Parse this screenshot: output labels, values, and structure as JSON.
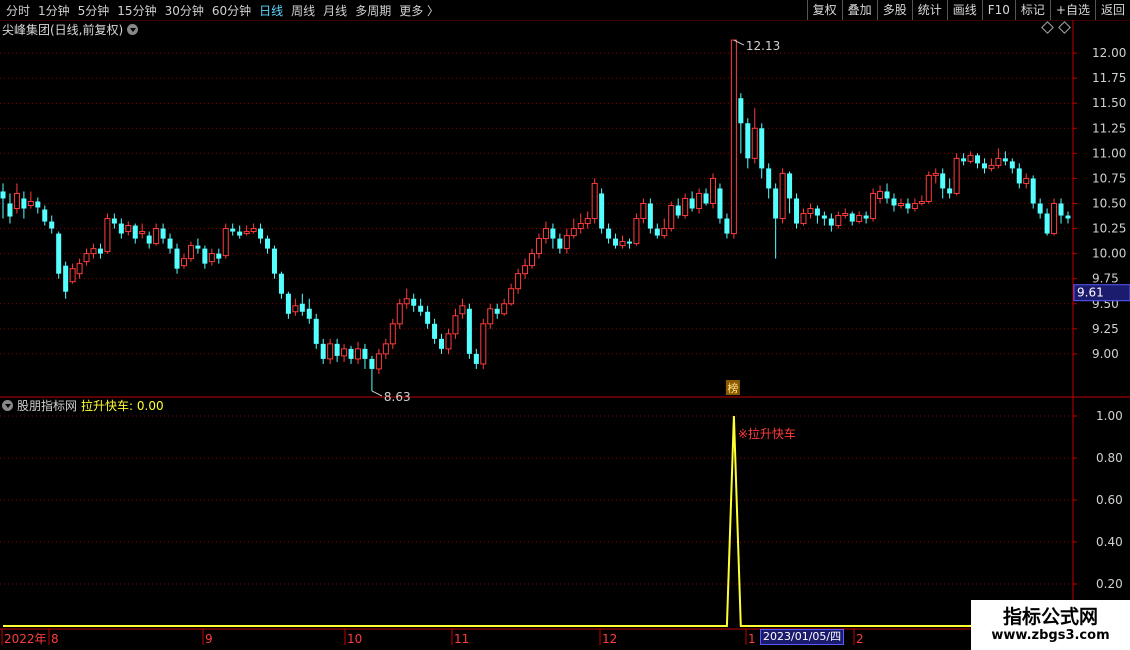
{
  "toolbar": {
    "periods": [
      {
        "label": "分时",
        "active": false
      },
      {
        "label": "1分钟",
        "active": false
      },
      {
        "label": "5分钟",
        "active": false
      },
      {
        "label": "15分钟",
        "active": false
      },
      {
        "label": "30分钟",
        "active": false
      },
      {
        "label": "60分钟",
        "active": false
      },
      {
        "label": "日线",
        "active": true
      },
      {
        "label": "周线",
        "active": false
      },
      {
        "label": "月线",
        "active": false
      },
      {
        "label": "多周期",
        "active": false
      },
      {
        "label": "更多 〉",
        "active": false
      }
    ],
    "right_buttons": [
      "复权",
      "叠加",
      "多股",
      "统计",
      "画线",
      "F10",
      "标记",
      "+自选",
      "返回"
    ]
  },
  "stock": {
    "title": "尖峰集团(日线,前复权)",
    "high_label": "12.13",
    "low_label": "8.63",
    "current_price_tag": "9.61",
    "rank_badge": "榜"
  },
  "price_axis": {
    "labels": [
      "12.00",
      "11.75",
      "11.50",
      "11.25",
      "11.00",
      "10.75",
      "10.50",
      "10.25",
      "10.00",
      "9.75",
      "9.50",
      "9.25",
      "9.00"
    ]
  },
  "indicator": {
    "name": "股朋指标网",
    "series_label": "拉升快车: 0.00",
    "signal_label": "※拉升快车",
    "axis_labels": [
      "1.00",
      "0.80",
      "0.60",
      "0.40",
      "0.20"
    ]
  },
  "time_axis": {
    "labels": [
      "2022年",
      "8",
      "9",
      "10",
      "11",
      "12",
      "1",
      "2"
    ],
    "selected_date": "2023/01/05/四"
  },
  "watermark": {
    "title": "指标公式网",
    "url": "www.zbgs3.com"
  },
  "colors": {
    "up": "#ff3c3c",
    "down": "#54ffff",
    "indicator_line": "#ffff33",
    "grid": "#8a0000",
    "axis_line": "#c00000"
  },
  "chart_data": {
    "type": "candlestick",
    "price_range": [
      8.6,
      12.2
    ],
    "candles": [
      [
        10.62,
        10.55,
        10.7,
        10.35
      ],
      [
        10.5,
        10.37,
        10.6,
        10.3
      ],
      [
        10.45,
        10.6,
        10.7,
        10.4
      ],
      [
        10.55,
        10.45,
        10.62,
        10.35
      ],
      [
        10.48,
        10.52,
        10.62,
        10.45
      ],
      [
        10.52,
        10.46,
        10.56,
        10.4
      ],
      [
        10.44,
        10.32,
        10.48,
        10.28
      ],
      [
        10.32,
        10.25,
        10.38,
        10.2
      ],
      [
        10.2,
        9.8,
        10.22,
        9.75
      ],
      [
        9.88,
        9.62,
        9.92,
        9.55
      ],
      [
        9.72,
        9.85,
        9.9,
        9.7
      ],
      [
        9.8,
        9.9,
        9.95,
        9.75
      ],
      [
        9.92,
        10.0,
        10.05,
        9.88
      ],
      [
        10.0,
        10.05,
        10.1,
        9.95
      ],
      [
        10.05,
        10.0,
        10.1,
        9.95
      ],
      [
        10.02,
        10.35,
        10.4,
        10.0
      ],
      [
        10.35,
        10.3,
        10.4,
        10.25
      ],
      [
        10.3,
        10.2,
        10.35,
        10.15
      ],
      [
        10.22,
        10.28,
        10.32,
        10.18
      ],
      [
        10.28,
        10.15,
        10.3,
        10.1
      ],
      [
        10.2,
        10.22,
        10.3,
        10.15
      ],
      [
        10.18,
        10.1,
        10.22,
        10.05
      ],
      [
        10.1,
        10.25,
        10.3,
        10.08
      ],
      [
        10.25,
        10.15,
        10.3,
        10.1
      ],
      [
        10.15,
        10.05,
        10.2,
        10.0
      ],
      [
        10.05,
        9.85,
        10.1,
        9.8
      ],
      [
        9.88,
        9.95,
        10.0,
        9.85
      ],
      [
        9.95,
        10.08,
        10.12,
        9.92
      ],
      [
        10.08,
        10.05,
        10.15,
        10.0
      ],
      [
        10.05,
        9.9,
        10.08,
        9.85
      ],
      [
        9.92,
        10.0,
        10.05,
        9.88
      ],
      [
        10.0,
        9.95,
        10.05,
        9.9
      ],
      [
        9.98,
        10.25,
        10.3,
        9.95
      ],
      [
        10.25,
        10.22,
        10.3,
        10.18
      ],
      [
        10.22,
        10.18,
        10.28,
        10.15
      ],
      [
        10.2,
        10.22,
        10.28,
        10.18
      ],
      [
        10.22,
        10.25,
        10.3,
        10.2
      ],
      [
        10.25,
        10.15,
        10.3,
        10.1
      ],
      [
        10.15,
        10.05,
        10.18,
        10.0
      ],
      [
        10.05,
        9.8,
        10.08,
        9.75
      ],
      [
        9.8,
        9.6,
        9.82,
        9.55
      ],
      [
        9.6,
        9.4,
        9.62,
        9.35
      ],
      [
        9.42,
        9.48,
        9.55,
        9.38
      ],
      [
        9.5,
        9.42,
        9.6,
        9.38
      ],
      [
        9.45,
        9.35,
        9.55,
        9.3
      ],
      [
        9.35,
        9.1,
        9.4,
        9.05
      ],
      [
        9.1,
        8.95,
        9.15,
        8.9
      ],
      [
        8.95,
        9.1,
        9.15,
        8.9
      ],
      [
        9.1,
        8.98,
        9.15,
        8.92
      ],
      [
        8.98,
        9.05,
        9.1,
        8.92
      ],
      [
        9.05,
        8.95,
        9.08,
        8.9
      ],
      [
        8.95,
        9.05,
        9.12,
        8.9
      ],
      [
        9.05,
        8.95,
        9.1,
        8.85
      ],
      [
        8.95,
        8.85,
        8.98,
        8.63
      ],
      [
        8.85,
        9.0,
        9.05,
        8.8
      ],
      [
        9.0,
        9.1,
        9.15,
        8.95
      ],
      [
        9.1,
        9.3,
        9.35,
        9.05
      ],
      [
        9.3,
        9.5,
        9.55,
        9.25
      ],
      [
        9.5,
        9.55,
        9.65,
        9.45
      ],
      [
        9.55,
        9.48,
        9.6,
        9.42
      ],
      [
        9.48,
        9.42,
        9.55,
        9.38
      ],
      [
        9.42,
        9.3,
        9.48,
        9.25
      ],
      [
        9.3,
        9.15,
        9.35,
        9.1
      ],
      [
        9.15,
        9.05,
        9.2,
        9.0
      ],
      [
        9.05,
        9.2,
        9.25,
        9.0
      ],
      [
        9.2,
        9.38,
        9.45,
        9.15
      ],
      [
        9.4,
        9.48,
        9.55,
        9.35
      ],
      [
        9.45,
        9.0,
        9.5,
        8.95
      ],
      [
        9.0,
        8.9,
        9.05,
        8.85
      ],
      [
        8.9,
        9.3,
        9.35,
        8.85
      ],
      [
        9.3,
        9.45,
        9.5,
        9.25
      ],
      [
        9.45,
        9.4,
        9.5,
        9.35
      ],
      [
        9.4,
        9.5,
        9.55,
        9.38
      ],
      [
        9.5,
        9.65,
        9.7,
        9.48
      ],
      [
        9.65,
        9.8,
        9.85,
        9.6
      ],
      [
        9.8,
        9.88,
        9.95,
        9.75
      ],
      [
        9.88,
        10.0,
        10.05,
        9.85
      ],
      [
        10.0,
        10.15,
        10.2,
        9.95
      ],
      [
        10.15,
        10.25,
        10.32,
        10.1
      ],
      [
        10.25,
        10.15,
        10.3,
        10.05
      ],
      [
        10.15,
        10.05,
        10.2,
        10.0
      ],
      [
        10.05,
        10.18,
        10.25,
        10.0
      ],
      [
        10.18,
        10.25,
        10.35,
        10.15
      ],
      [
        10.25,
        10.3,
        10.4,
        10.2
      ],
      [
        10.3,
        10.35,
        10.42,
        10.25
      ],
      [
        10.35,
        10.7,
        10.75,
        10.3
      ],
      [
        10.6,
        10.25,
        10.65,
        10.2
      ],
      [
        10.25,
        10.15,
        10.3,
        10.1
      ],
      [
        10.15,
        10.08,
        10.2,
        10.05
      ],
      [
        10.08,
        10.12,
        10.18,
        10.05
      ],
      [
        10.12,
        10.1,
        10.15,
        10.05
      ],
      [
        10.1,
        10.35,
        10.4,
        10.08
      ],
      [
        10.35,
        10.5,
        10.55,
        10.3
      ],
      [
        10.5,
        10.25,
        10.55,
        10.2
      ],
      [
        10.25,
        10.18,
        10.3,
        10.15
      ],
      [
        10.18,
        10.25,
        10.35,
        10.15
      ],
      [
        10.25,
        10.48,
        10.52,
        10.22
      ],
      [
        10.48,
        10.38,
        10.55,
        10.35
      ],
      [
        10.38,
        10.55,
        10.6,
        10.35
      ],
      [
        10.55,
        10.45,
        10.62,
        10.42
      ],
      [
        10.45,
        10.6,
        10.65,
        10.4
      ],
      [
        10.6,
        10.5,
        10.65,
        10.48
      ],
      [
        10.5,
        10.75,
        10.8,
        10.45
      ],
      [
        10.65,
        10.35,
        10.7,
        10.3
      ],
      [
        10.35,
        10.2,
        10.4,
        10.15
      ],
      [
        10.2,
        12.13,
        12.13,
        10.15
      ],
      [
        11.55,
        11.3,
        11.6,
        11.0
      ],
      [
        11.3,
        10.95,
        11.35,
        10.85
      ],
      [
        10.95,
        11.25,
        11.45,
        10.9
      ],
      [
        11.25,
        10.85,
        11.3,
        10.75
      ],
      [
        10.85,
        10.65,
        10.9,
        10.55
      ],
      [
        10.65,
        10.35,
        10.7,
        9.95
      ],
      [
        10.35,
        10.8,
        10.85,
        10.3
      ],
      [
        10.8,
        10.55,
        10.82,
        10.4
      ],
      [
        10.55,
        10.3,
        10.6,
        10.25
      ],
      [
        10.3,
        10.4,
        10.45,
        10.28
      ],
      [
        10.4,
        10.45,
        10.5,
        10.35
      ],
      [
        10.45,
        10.38,
        10.48,
        10.3
      ],
      [
        10.38,
        10.35,
        10.42,
        10.28
      ],
      [
        10.35,
        10.28,
        10.4,
        10.22
      ],
      [
        10.28,
        10.38,
        10.42,
        10.25
      ],
      [
        10.38,
        10.4,
        10.45,
        10.35
      ],
      [
        10.4,
        10.32,
        10.42,
        10.28
      ],
      [
        10.32,
        10.38,
        10.42,
        10.3
      ],
      [
        10.38,
        10.35,
        10.42,
        10.3
      ],
      [
        10.35,
        10.6,
        10.65,
        10.32
      ],
      [
        10.55,
        10.62,
        10.68,
        10.5
      ],
      [
        10.62,
        10.55,
        10.7,
        10.5
      ],
      [
        10.55,
        10.48,
        10.6,
        10.42
      ],
      [
        10.48,
        10.5,
        10.55,
        10.45
      ],
      [
        10.5,
        10.45,
        10.55,
        10.4
      ],
      [
        10.45,
        10.5,
        10.55,
        10.42
      ],
      [
        10.5,
        10.52,
        10.58,
        10.48
      ],
      [
        10.52,
        10.78,
        10.82,
        10.5
      ],
      [
        10.78,
        10.8,
        10.85,
        10.7
      ],
      [
        10.8,
        10.65,
        10.85,
        10.55
      ],
      [
        10.65,
        10.6,
        10.75,
        10.55
      ],
      [
        10.6,
        10.95,
        11.0,
        10.58
      ],
      [
        10.95,
        10.92,
        11.0,
        10.88
      ],
      [
        10.92,
        10.98,
        11.02,
        10.9
      ],
      [
        10.98,
        10.9,
        11.0,
        10.85
      ],
      [
        10.9,
        10.85,
        10.95,
        10.8
      ],
      [
        10.85,
        10.88,
        10.95,
        10.82
      ],
      [
        10.88,
        10.95,
        11.05,
        10.85
      ],
      [
        10.95,
        10.92,
        11.02,
        10.88
      ],
      [
        10.92,
        10.85,
        10.95,
        10.8
      ],
      [
        10.85,
        10.7,
        10.9,
        10.65
      ],
      [
        10.7,
        10.75,
        10.8,
        10.65
      ],
      [
        10.75,
        10.5,
        10.78,
        10.45
      ],
      [
        10.5,
        10.4,
        10.55,
        10.35
      ],
      [
        10.4,
        10.2,
        10.45,
        10.18
      ],
      [
        10.2,
        10.5,
        10.55,
        10.18
      ],
      [
        10.5,
        10.38,
        10.55,
        10.3
      ],
      [
        10.38,
        10.35,
        10.42,
        10.3
      ]
    ],
    "indicator_peak_index": 105,
    "indicator_values": {
      "default": 0,
      "peak": 1.0
    }
  }
}
